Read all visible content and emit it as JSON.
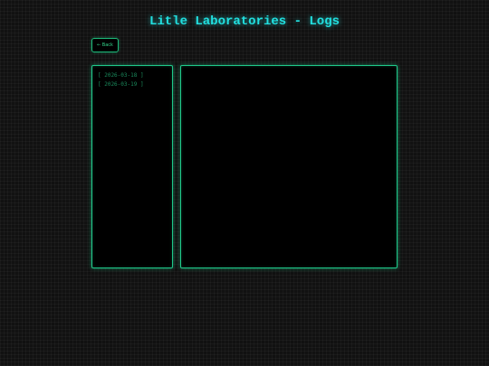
{
  "header": {
    "title": "Litle Laboratories - Logs"
  },
  "nav": {
    "back_label": "← Back"
  },
  "sidebar": {
    "log_entries": [
      {
        "label": "[ 2026-03-18 ]"
      },
      {
        "label": "[ 2026-03-19 ]"
      }
    ]
  },
  "content": {
    "text": ""
  },
  "colors": {
    "title": "#22e0e0",
    "accent": "#1fc98a",
    "background": "#111111",
    "panel": "#000000"
  }
}
